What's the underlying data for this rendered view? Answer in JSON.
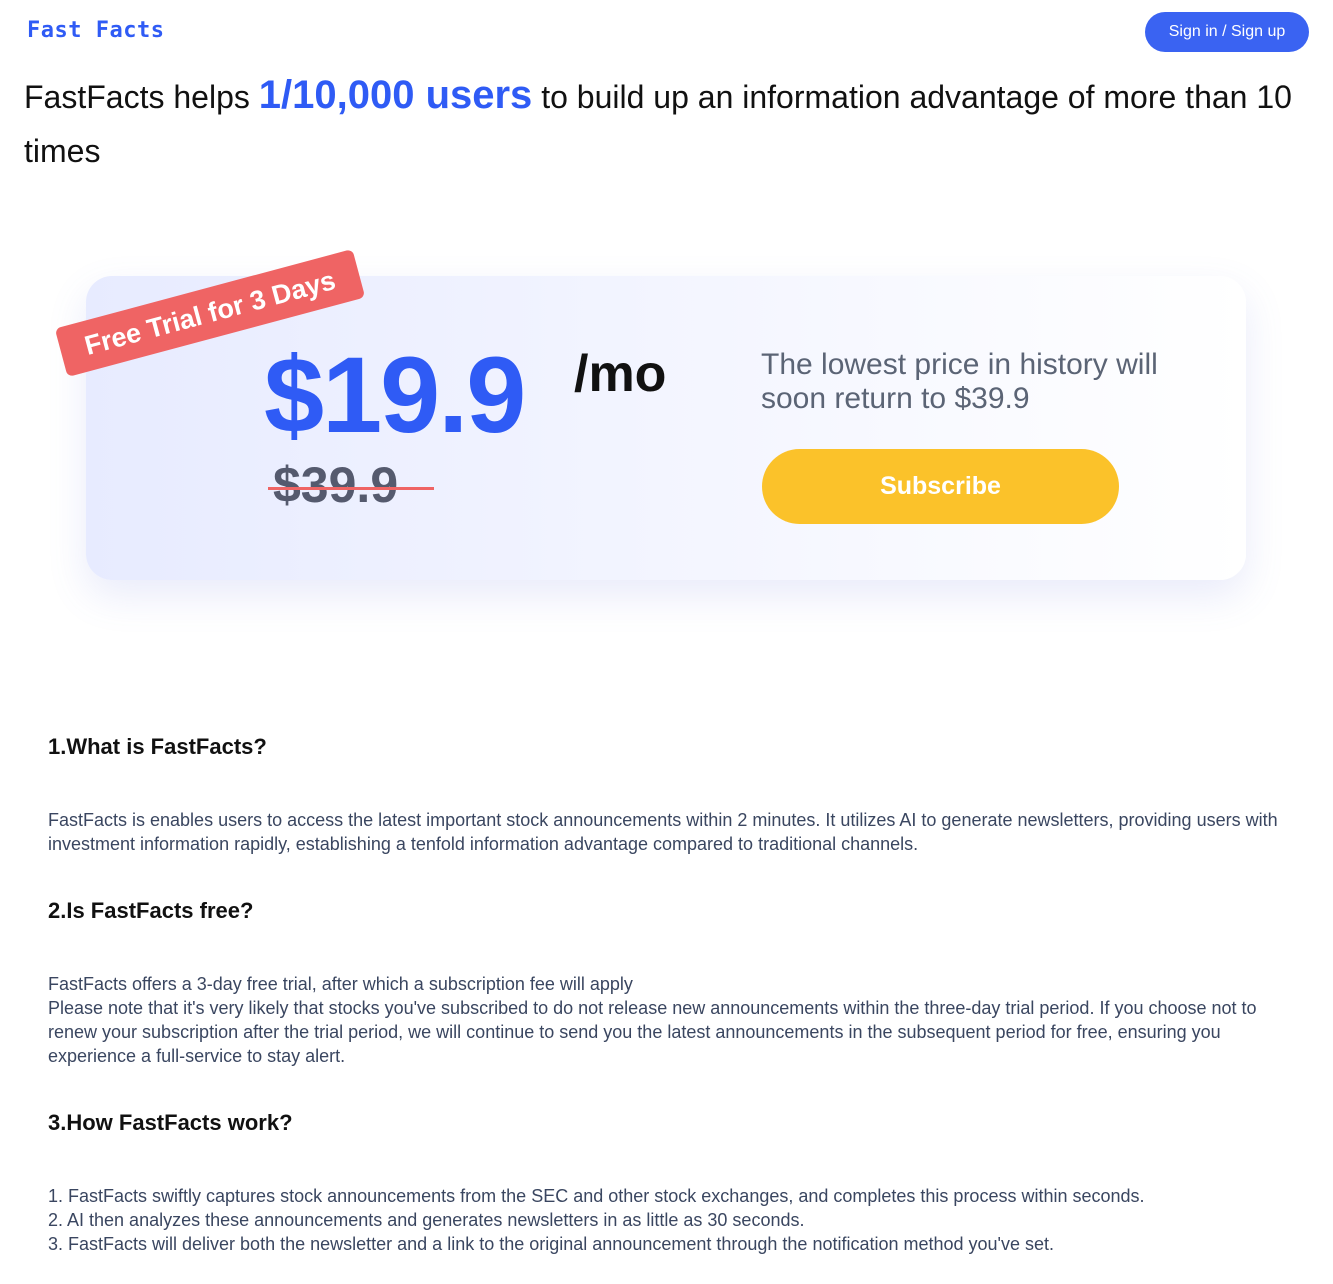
{
  "header": {
    "logo": "Fast Facts",
    "signin_label": "Sign in / Sign up"
  },
  "headline": {
    "before": "FastFacts helps ",
    "highlight": "1/10,000 users",
    "after": " to build up an information advantage of more than 10 times"
  },
  "pricing": {
    "ribbon": "Free Trial for 3 Days",
    "price": "$19.9",
    "unit": "/mo",
    "old_price": "$39.9",
    "note": "The lowest price in history will soon return to $39.9",
    "subscribe_label": "Subscribe"
  },
  "faq": [
    {
      "question": "1.What is FastFacts?",
      "answer": [
        "FastFacts is enables users to access the latest important stock announcements within 2 minutes. It utilizes AI to generate newsletters, providing users with investment information rapidly, establishing a tenfold information advantage compared to traditional channels."
      ]
    },
    {
      "question": "2.Is FastFacts free?",
      "answer": [
        "FastFacts offers a 3-day free trial, after which a subscription fee will apply",
        "Please note that it's very likely that stocks you've subscribed to do not release new announcements within the three-day trial period. If you choose not to renew your subscription after the trial period, we will continue to send you the latest announcements in the subsequent period for free, ensuring you experience a full-service to stay alert."
      ]
    },
    {
      "question": "3.How FastFacts work?",
      "answer": [
        "1. FastFacts swiftly captures stock announcements from the SEC and other stock exchanges, and completes this process within seconds.",
        "2. AI then analyzes these announcements and generates newsletters in as little as 30 seconds.",
        "3. FastFacts will deliver both the newsletter and a link to the original announcement through the notification method you've set."
      ]
    }
  ],
  "colors": {
    "brand": "#2f5bf5",
    "ribbon": "#ef6464",
    "subscribe": "#fbc22a"
  }
}
